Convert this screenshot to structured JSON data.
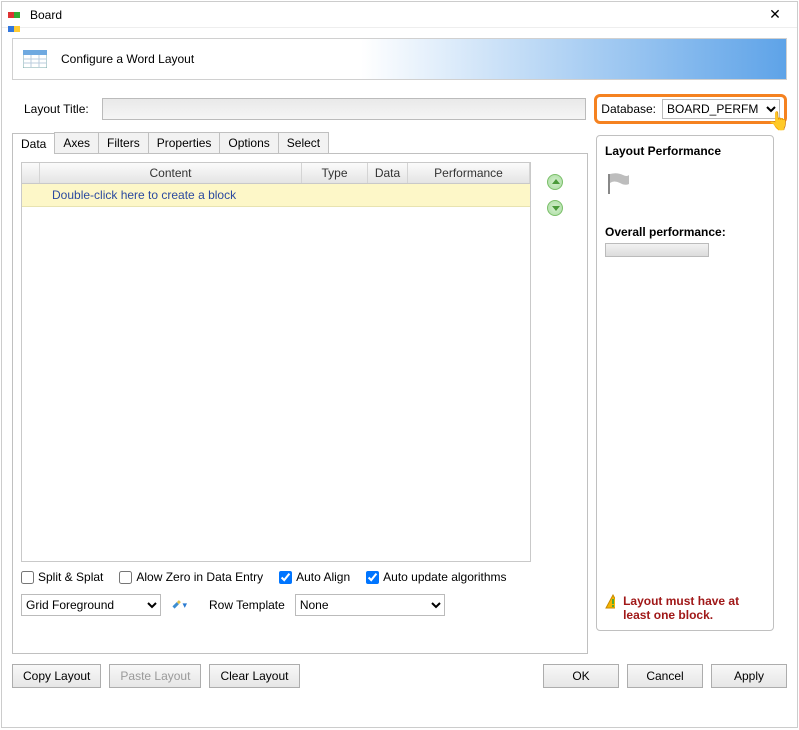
{
  "window": {
    "title": "Board"
  },
  "header": {
    "subtitle": "Configure a Word Layout"
  },
  "labels": {
    "layout_title": "Layout Title:",
    "database": "Database:",
    "row_template": "Row Template"
  },
  "fields": {
    "layout_title_value": "",
    "database_value": "BOARD_PERFM",
    "grid_foreground": "Grid Foreground",
    "row_template_value": "None"
  },
  "tabs": [
    "Data",
    "Axes",
    "Filters",
    "Properties",
    "Options",
    "Select"
  ],
  "grid_headers": {
    "content": "Content",
    "type": "Type",
    "data": "Data",
    "performance": "Performance"
  },
  "grid_placeholder": "Double-click here to create a block",
  "checkboxes": {
    "split_splat": {
      "label": "Split & Splat",
      "checked": false
    },
    "allow_zero": {
      "label": "Alow Zero in Data Entry",
      "checked": false
    },
    "auto_align": {
      "label": "Auto Align",
      "checked": true
    },
    "auto_update": {
      "label": "Auto update algorithms",
      "checked": true
    }
  },
  "performance": {
    "title": "Layout Performance",
    "overall_label": "Overall performance:",
    "warning": "Layout must have at least one block."
  },
  "buttons": {
    "copy": "Copy Layout",
    "paste": "Paste Layout",
    "clear": "Clear Layout",
    "ok": "OK",
    "cancel": "Cancel",
    "apply": "Apply"
  }
}
